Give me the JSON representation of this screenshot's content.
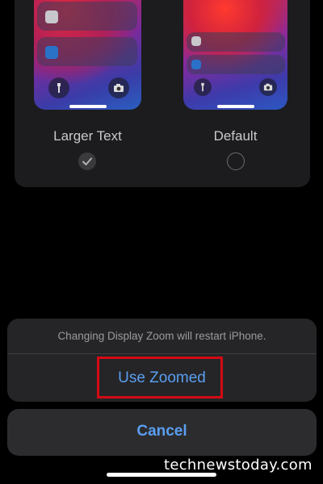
{
  "display_zoom": {
    "options": [
      {
        "label": "Larger Text",
        "selected": true
      },
      {
        "label": "Default",
        "selected": false
      }
    ]
  },
  "action_sheet": {
    "message": "Changing Display Zoom will restart iPhone.",
    "confirm_label": "Use Zoomed",
    "cancel_label": "Cancel"
  },
  "watermark": "technewstoday.com",
  "colors": {
    "accent": "#5a9ef0",
    "highlight_box": "#d40a14",
    "sheet_bg": "#252527",
    "background": "#000000"
  }
}
